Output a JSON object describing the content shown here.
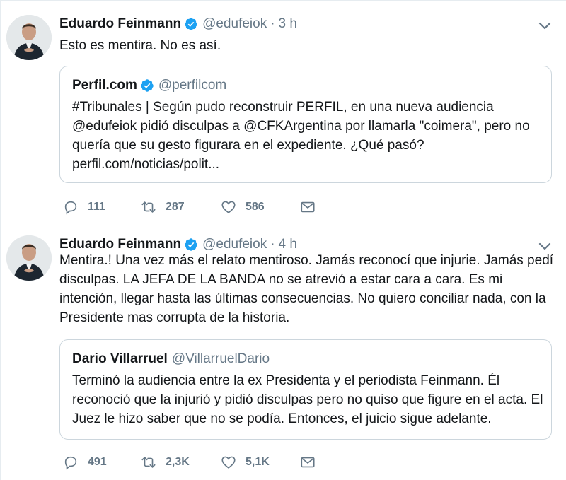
{
  "tweets": [
    {
      "name": "Eduardo Feinmann",
      "handle": "@edufeiok",
      "separator": "·",
      "time": "3 h",
      "text": "Esto es mentira. No es así.",
      "quote": {
        "name": "Perfil.com",
        "handle": "@perfilcom",
        "verified": true,
        "text": "#Tribunales | Según pudo reconstruir PERFIL, en una nueva audiencia @edufeiok pidió disculpas a @CFKArgentina por llamarla  \"coimera\", pero no quería que su gesto figurara en el expediente. ¿Qué pasó? perfil.com/noticias/polit..."
      },
      "replies": "111",
      "retweets": "287",
      "likes": "586"
    },
    {
      "name": "Eduardo Feinmann",
      "handle": "@edufeiok",
      "separator": "·",
      "time": "4 h",
      "text": "Mentira.!  Una vez más el relato mentiroso. Jamás reconocí que injurie. Jamás pedí disculpas. LA JEFA DE LA BANDA no se atrevió a estar cara a cara. Es mi intención, llegar hasta las últimas consecuencias. No quiero conciliar nada, con la Presidente mas corrupta de la historia.",
      "quote": {
        "name": "Dario Villarruel",
        "handle": "@VillarruelDario",
        "verified": false,
        "text": "Terminó la audiencia entre la ex Presidenta y el periodista Feinmann. Él reconoció que la injurió y pidió disculpas pero no quiso que figure en el acta. El Juez le hizo saber que no se podía. Entonces, el juicio sigue adelante."
      },
      "replies": "491",
      "retweets": "2,3K",
      "likes": "5,1K"
    }
  ],
  "colors": {
    "verified": "#1da1f2",
    "muted": "#657786",
    "border": "#ccd6dd",
    "text": "#14171a"
  },
  "icons": [
    "verified-badge-icon",
    "chevron-down-icon",
    "reply-icon",
    "retweet-icon",
    "heart-icon",
    "envelope-icon"
  ]
}
